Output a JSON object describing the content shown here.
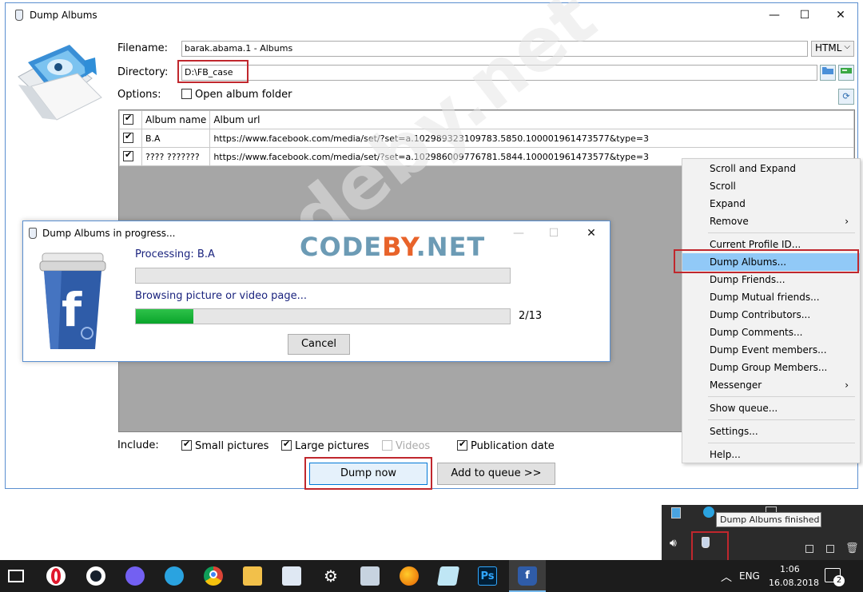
{
  "window": {
    "title": "Dump Albums",
    "controls": {
      "minimize": "—",
      "maximize": "☐",
      "close": "✕"
    }
  },
  "form": {
    "filename_label": "Filename:",
    "filename_value": "barak.abama.1 - Albums",
    "format_value": "HTML",
    "directory_label": "Directory:",
    "directory_value": "D:\\FB_case",
    "options_label": "Options:",
    "open_album_folder": "Open album folder"
  },
  "table": {
    "columns": [
      "Album name",
      "Album url"
    ],
    "rows": [
      {
        "name": "B.A",
        "url": "https://www.facebook.com/media/set/?set=a.102989323109783.5850.100001961473577&type=3"
      },
      {
        "name": "???? ???????",
        "url": "https://www.facebook.com/media/set/?set=a.102986009776781.5844.100001961473577&type=3"
      }
    ]
  },
  "include": {
    "label": "Include:",
    "small_pictures": "Small pictures",
    "large_pictures": "Large pictures",
    "videos": "Videos",
    "publication_date": "Publication date"
  },
  "buttons": {
    "dump_now": "Dump now",
    "add_to_queue": "Add to queue >>"
  },
  "progress": {
    "title": "Dump Albums in progress...",
    "processing": "Processing: B.A",
    "status": "Browsing picture or video page...",
    "counter": "2/13",
    "cancel": "Cancel",
    "fraction": 0.154
  },
  "watermark": {
    "brand_a": "CODE",
    "brand_b": "BY",
    "brand_c": ".NET",
    "diagonal": "codeby.net"
  },
  "menu": {
    "items": [
      {
        "label": "Scroll and Expand"
      },
      {
        "label": "Scroll"
      },
      {
        "label": "Expand"
      },
      {
        "label": "Remove",
        "arrow": "›"
      },
      {
        "label": "Current Profile ID..."
      },
      {
        "label": "Dump Albums..."
      },
      {
        "label": "Dump Friends..."
      },
      {
        "label": "Dump Mutual friends..."
      },
      {
        "label": "Dump Contributors..."
      },
      {
        "label": "Dump Comments..."
      },
      {
        "label": "Dump Event members..."
      },
      {
        "label": "Dump Group Members..."
      },
      {
        "label": "Messenger",
        "arrow": "›"
      },
      {
        "label": "Show queue..."
      },
      {
        "label": "Settings..."
      },
      {
        "label": "Help..."
      }
    ]
  },
  "tray": {
    "tooltip": "Dump Albums finished"
  },
  "taskbar": {
    "lang": "ENG",
    "time": "1:06",
    "date": "16.08.2018",
    "notifications": "2",
    "ps_label": "Ps",
    "fb_label": "f"
  }
}
